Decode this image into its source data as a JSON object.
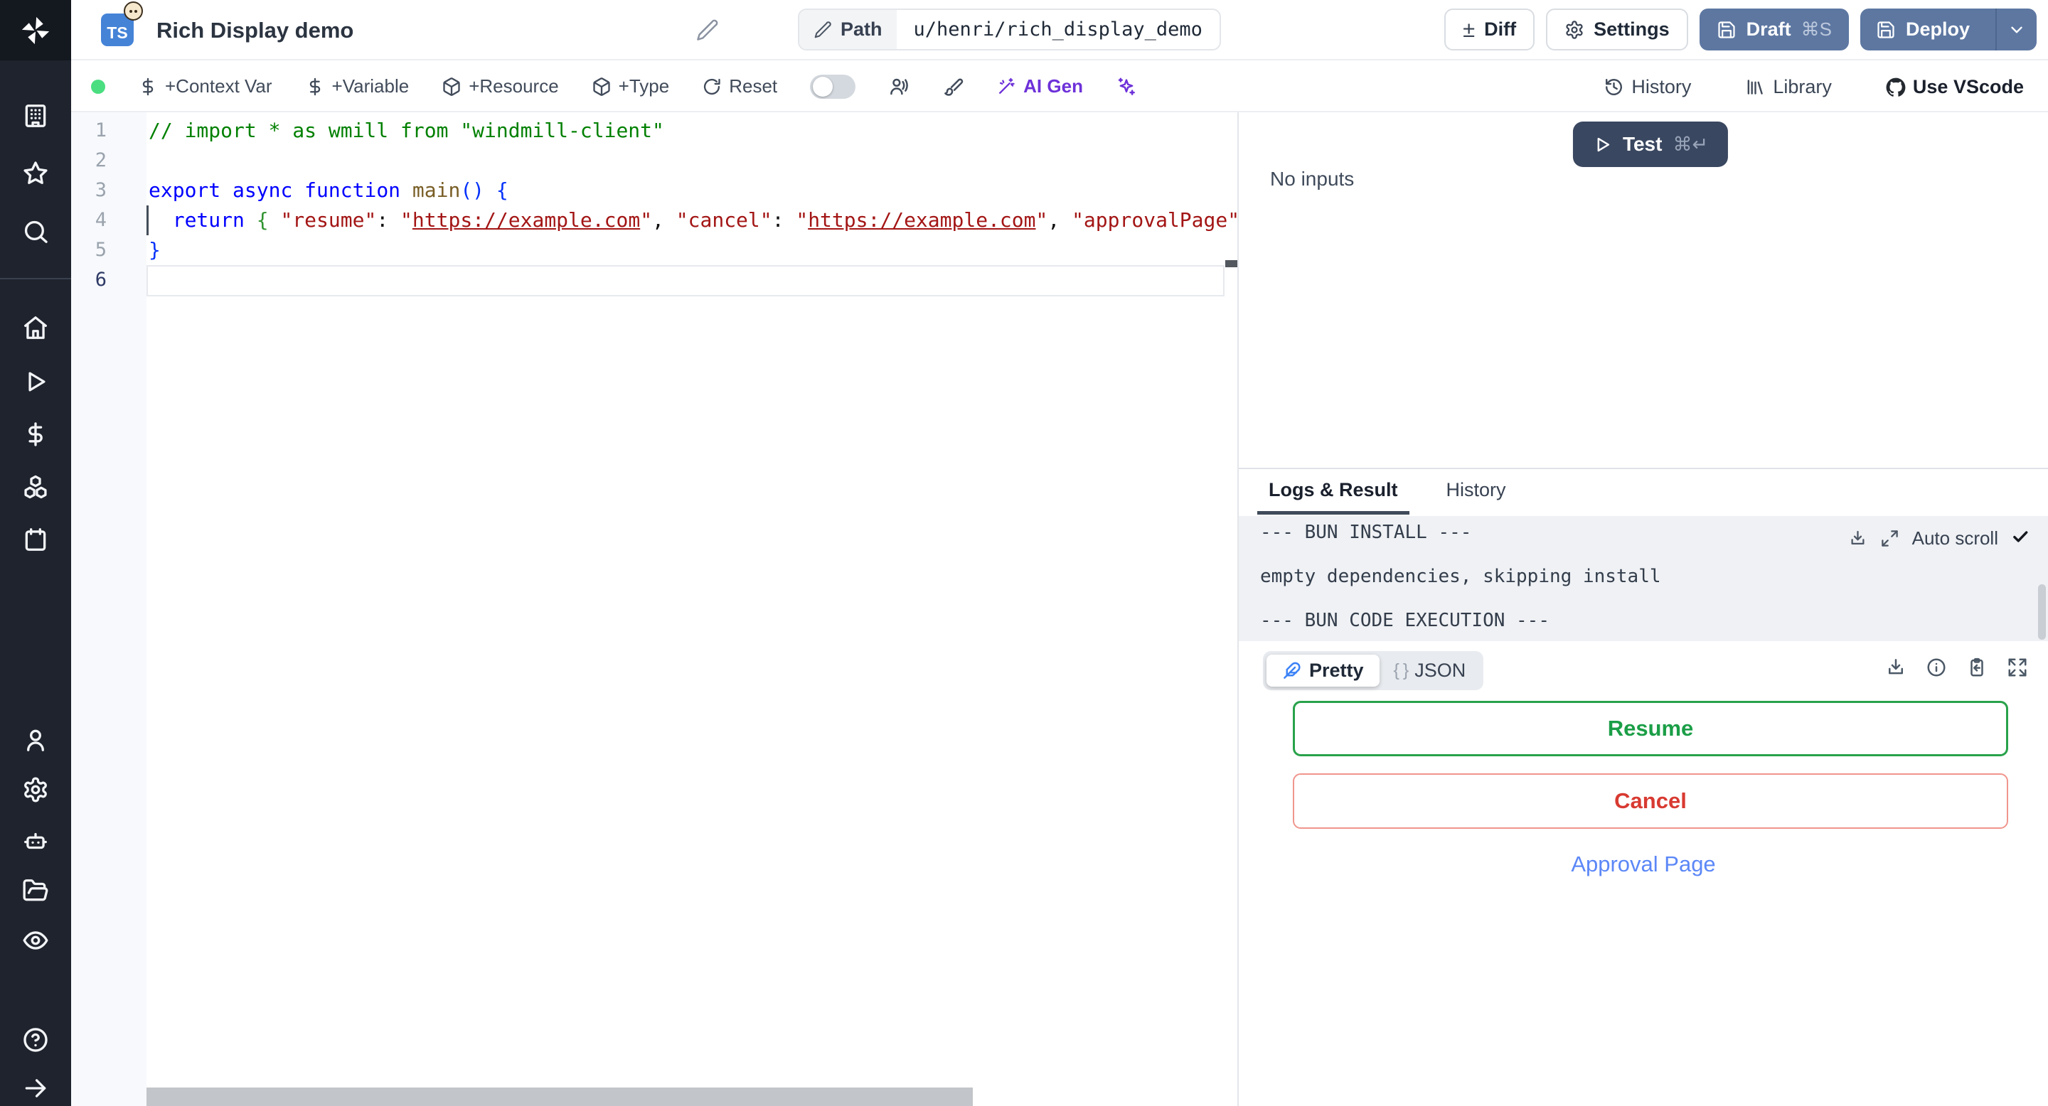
{
  "topbar": {
    "lang_badge": "TS",
    "title": "Rich Display demo",
    "path_label": "Path",
    "path_value": "u/henri/rich_display_demo",
    "diff_label": "Diff",
    "diff_glyph": "±",
    "settings_label": "Settings",
    "draft_label": "Draft",
    "draft_kbd": "⌘S",
    "deploy_label": "Deploy"
  },
  "toolbar": {
    "context_var": "+Context Var",
    "variable": "+Variable",
    "resource": "+Resource",
    "type": "+Type",
    "reset": "Reset",
    "ai_gen": "AI Gen",
    "history": "History",
    "library": "Library",
    "use_vscode": "Use VScode"
  },
  "editor": {
    "lines": [
      {
        "num": "1",
        "active": false,
        "tokens": [
          {
            "t": "// import * as wmill from \"windmill-client\"",
            "s": "comment"
          }
        ]
      },
      {
        "num": "2",
        "active": false,
        "tokens": []
      },
      {
        "num": "3",
        "active": false,
        "tokens": [
          {
            "t": "export",
            "s": "kw"
          },
          {
            "t": " ",
            "s": "plain"
          },
          {
            "t": "async",
            "s": "kw"
          },
          {
            "t": " ",
            "s": "plain"
          },
          {
            "t": "function",
            "s": "kw"
          },
          {
            "t": " ",
            "s": "plain"
          },
          {
            "t": "main",
            "s": "fn"
          },
          {
            "t": "()",
            "s": "b1"
          },
          {
            "t": " ",
            "s": "plain"
          },
          {
            "t": "{",
            "s": "b1"
          }
        ]
      },
      {
        "num": "4",
        "active": false,
        "tokens": [
          {
            "t": "  ",
            "s": "plain"
          },
          {
            "t": "return",
            "s": "kw"
          },
          {
            "t": " ",
            "s": "plain"
          },
          {
            "t": "{",
            "s": "b2"
          },
          {
            "t": " ",
            "s": "plain"
          },
          {
            "t": "\"resume\"",
            "s": "str"
          },
          {
            "t": ": ",
            "s": "plain"
          },
          {
            "t": "\"",
            "s": "str"
          },
          {
            "t": "https://example.com",
            "s": "link"
          },
          {
            "t": "\"",
            "s": "str"
          },
          {
            "t": ", ",
            "s": "plain"
          },
          {
            "t": "\"cancel\"",
            "s": "str"
          },
          {
            "t": ": ",
            "s": "plain"
          },
          {
            "t": "\"",
            "s": "str"
          },
          {
            "t": "https://example.com",
            "s": "link"
          },
          {
            "t": "\"",
            "s": "str"
          },
          {
            "t": ", ",
            "s": "plain"
          },
          {
            "t": "\"approvalPage\"",
            "s": "str"
          },
          {
            "t": ": ",
            "s": "plain"
          }
        ]
      },
      {
        "num": "5",
        "active": false,
        "tokens": [
          {
            "t": "}",
            "s": "b1"
          }
        ]
      },
      {
        "num": "6",
        "active": true,
        "tokens": []
      }
    ]
  },
  "run": {
    "test_label": "Test",
    "test_kbd": "⌘↵",
    "no_inputs": "No inputs"
  },
  "tabs": {
    "logs_result": "Logs & Result",
    "history": "History"
  },
  "logs": {
    "lines": [
      "--- BUN INSTALL ---",
      "",
      "empty dependencies, skipping install",
      "",
      "--- BUN CODE EXECUTION ---"
    ],
    "auto_scroll": "Auto scroll"
  },
  "result": {
    "pretty_label": "Pretty",
    "json_braces": "{ }",
    "json_label": "JSON",
    "resume_label": "Resume",
    "cancel_label": "Cancel",
    "approval_label": "Approval Page"
  },
  "colors": {
    "accent_slate_button": "#5d77a1",
    "test_button": "#3a4760",
    "sidebar_bg": "#1e232d",
    "status_dot_green": "#4ade80",
    "ai_purple": "#6d31d9",
    "resume_green": "#1b9e47",
    "cancel_red": "#d83a31",
    "approval_blue": "#5b87f7",
    "ts_badge_blue": "#4583d7",
    "log_bg": "#eff1f4"
  }
}
